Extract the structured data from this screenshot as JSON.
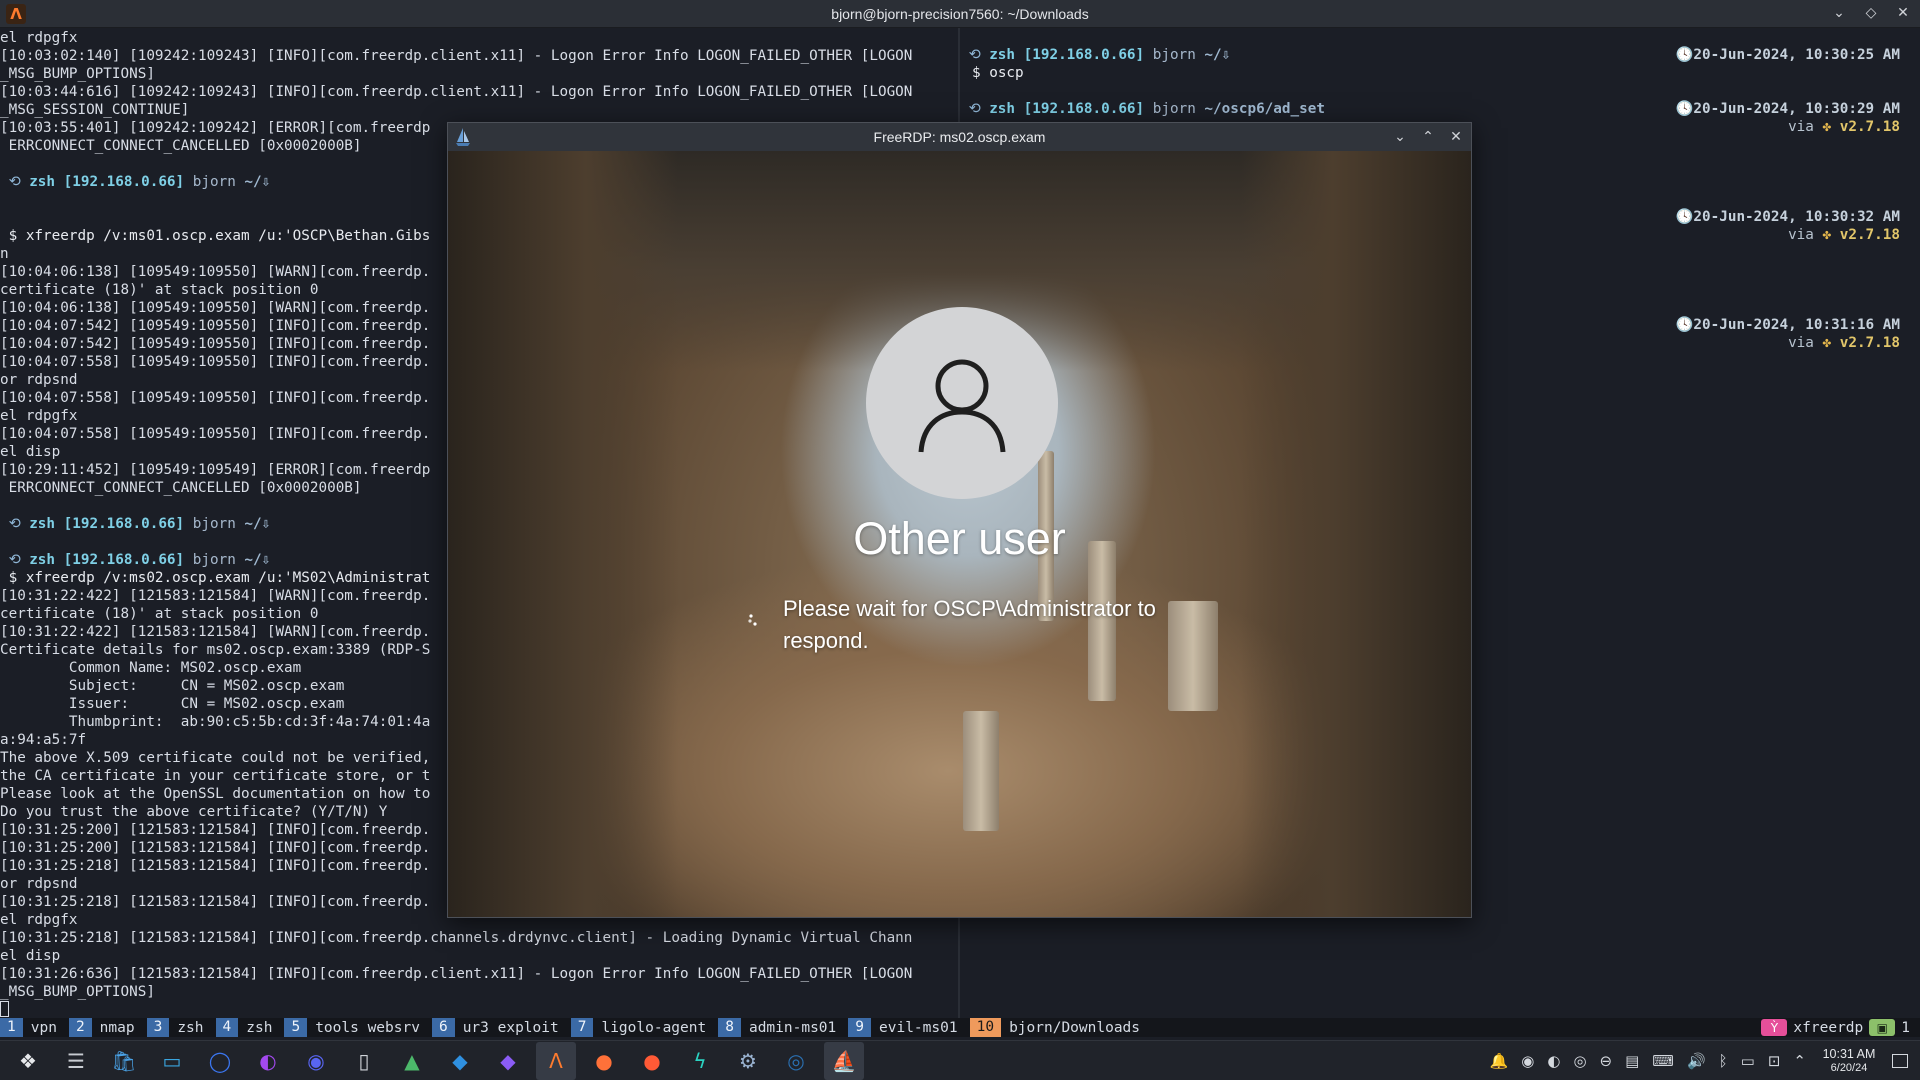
{
  "window": {
    "title": "bjorn@bjorn-precision7560: ~/Downloads",
    "controls": [
      "⌄",
      "◇",
      "✕"
    ]
  },
  "terminal_left": {
    "lines": [
      {
        "t": "out",
        "text": "el rdpgfx"
      },
      {
        "t": "out",
        "text": "[10:03:02:140] [109242:109243] [INFO][com.freerdp.client.x11] - Logon Error Info LOGON_FAILED_OTHER [LOGON"
      },
      {
        "t": "out",
        "text": "_MSG_BUMP_OPTIONS]"
      },
      {
        "t": "out",
        "text": "[10:03:44:616] [109242:109243] [INFO][com.freerdp.client.x11] - Logon Error Info LOGON_FAILED_OTHER [LOGON"
      },
      {
        "t": "out",
        "text": "_MSG_SESSION_CONTINUE]"
      },
      {
        "t": "out",
        "text": "[10:03:55:401] [109242:109242] [ERROR][com.freerdp"
      },
      {
        "t": "out",
        "text": " ERRCONNECT_CONNECT_CANCELLED [0x0002000B]"
      },
      {
        "t": "blank",
        "text": ""
      },
      {
        "t": "prompt",
        "zsh": "zsh",
        "ip": "[192.168.0.66]",
        "user": "bjorn",
        "path": "~/⇩"
      },
      {
        "t": "blank",
        "text": ""
      },
      {
        "t": "blank",
        "text": ""
      },
      {
        "t": "cmd",
        "text": " $ xfreerdp /v:ms01.oscp.exam /u:'OSCP\\Bethan.Gibs"
      },
      {
        "t": "out",
        "text": "n"
      },
      {
        "t": "out",
        "text": "[10:04:06:138] [109549:109550] [WARN][com.freerdp."
      },
      {
        "t": "out",
        "text": "certificate (18)' at stack position 0"
      },
      {
        "t": "out",
        "text": "[10:04:06:138] [109549:109550] [WARN][com.freerdp."
      },
      {
        "t": "out",
        "text": "[10:04:07:542] [109549:109550] [INFO][com.freerdp."
      },
      {
        "t": "out",
        "text": "[10:04:07:542] [109549:109550] [INFO][com.freerdp."
      },
      {
        "t": "out",
        "text": "[10:04:07:558] [109549:109550] [INFO][com.freerdp."
      },
      {
        "t": "out",
        "text": "or rdpsnd"
      },
      {
        "t": "out",
        "text": "[10:04:07:558] [109549:109550] [INFO][com.freerdp."
      },
      {
        "t": "out",
        "text": "el rdpgfx"
      },
      {
        "t": "out",
        "text": "[10:04:07:558] [109549:109550] [INFO][com.freerdp."
      },
      {
        "t": "out",
        "text": "el disp"
      },
      {
        "t": "out",
        "text": "[10:29:11:452] [109549:109549] [ERROR][com.freerdp"
      },
      {
        "t": "out",
        "text": " ERRCONNECT_CONNECT_CANCELLED [0x0002000B]"
      },
      {
        "t": "blank",
        "text": ""
      },
      {
        "t": "prompt",
        "zsh": "zsh",
        "ip": "[192.168.0.66]",
        "user": "bjorn",
        "path": "~/⇩"
      },
      {
        "t": "blank",
        "text": ""
      },
      {
        "t": "prompt",
        "zsh": "zsh",
        "ip": "[192.168.0.66]",
        "user": "bjorn",
        "path": "~/⇩"
      },
      {
        "t": "cmd",
        "text": " $ xfreerdp /v:ms02.oscp.exam /u:'MS02\\Administrat"
      },
      {
        "t": "out",
        "text": "[10:31:22:422] [121583:121584] [WARN][com.freerdp."
      },
      {
        "t": "out",
        "text": "certificate (18)' at stack position 0"
      },
      {
        "t": "out",
        "text": "[10:31:22:422] [121583:121584] [WARN][com.freerdp."
      },
      {
        "t": "out",
        "text": "Certificate details for ms02.oscp.exam:3389 (RDP-S"
      },
      {
        "t": "out",
        "text": "        Common Name: MS02.oscp.exam"
      },
      {
        "t": "out",
        "text": "        Subject:     CN = MS02.oscp.exam"
      },
      {
        "t": "out",
        "text": "        Issuer:      CN = MS02.oscp.exam"
      },
      {
        "t": "out",
        "text": "        Thumbprint:  ab:90:c5:5b:cd:3f:4a:74:01:4a"
      },
      {
        "t": "out",
        "text": "a:94:a5:7f"
      },
      {
        "t": "out",
        "text": "The above X.509 certificate could not be verified,"
      },
      {
        "t": "out",
        "text": "the CA certificate in your certificate store, or t"
      },
      {
        "t": "out",
        "text": "Please look at the OpenSSL documentation on how to"
      },
      {
        "t": "out",
        "text": "Do you trust the above certificate? (Y/T/N) Y"
      },
      {
        "t": "out",
        "text": "[10:31:25:200] [121583:121584] [INFO][com.freerdp."
      },
      {
        "t": "out",
        "text": "[10:31:25:200] [121583:121584] [INFO][com.freerdp."
      },
      {
        "t": "out",
        "text": "[10:31:25:218] [121583:121584] [INFO][com.freerdp."
      },
      {
        "t": "out",
        "text": "or rdpsnd"
      },
      {
        "t": "out",
        "text": "[10:31:25:218] [121583:121584] [INFO][com.freerdp."
      },
      {
        "t": "out",
        "text": "el rdpgfx"
      },
      {
        "t": "out",
        "text": "[10:31:25:218] [121583:121584] [INFO][com.freerdp.channels.drdynvc.client] - Loading Dynamic Virtual Chann"
      },
      {
        "t": "out",
        "text": "el disp"
      },
      {
        "t": "out",
        "text": "[10:31:26:636] [121583:121584] [INFO][com.freerdp.client.x11] - Logon Error Info LOGON_FAILED_OTHER [LOGON"
      },
      {
        "t": "out",
        "text": "_MSG_BUMP_OPTIONS]"
      },
      {
        "t": "cursor",
        "text": ""
      }
    ]
  },
  "terminal_right": {
    "lines": [
      {
        "t": "prompt",
        "zsh": "zsh",
        "ip": "[192.168.0.66]",
        "user": "bjorn",
        "path": "~/⇩",
        "ts": "20-Jun-2024, 10:30:25 AM"
      },
      {
        "t": "cmd",
        "text": "$ oscp"
      },
      {
        "t": "blank",
        "text": ""
      },
      {
        "t": "prompt",
        "zsh": "zsh",
        "ip": "[192.168.0.66]",
        "user": "bjorn",
        "path": "~/oscp6/ad_set",
        "ts": "20-Jun-2024, 10:30:29 AM"
      },
      {
        "t": "via",
        "via": "via",
        "ver": "v2.7.18"
      },
      {
        "t": "blank",
        "text": ""
      },
      {
        "t": "blank",
        "text": ""
      },
      {
        "t": "blank",
        "text": ""
      },
      {
        "t": "blank",
        "text": ""
      },
      {
        "t": "ts",
        "ts": "20-Jun-2024, 10:30:32 AM"
      },
      {
        "t": "via",
        "via": "via",
        "ver": "v2.7.18"
      },
      {
        "t": "blank",
        "text": ""
      },
      {
        "t": "blank",
        "text": ""
      },
      {
        "t": "blank",
        "text": ""
      },
      {
        "t": "blank",
        "text": ""
      },
      {
        "t": "ts",
        "ts": "20-Jun-2024, 10:31:16 AM"
      },
      {
        "t": "via",
        "via": "via",
        "ver": "v2.7.18"
      }
    ]
  },
  "rdp": {
    "title": "FreeRDP: ms02.oscp.exam",
    "controls": [
      "⌄",
      "⌃",
      "✕"
    ],
    "user_name": "Other user",
    "message": "Please wait for OSCP\\Administrator to respond."
  },
  "workspaces": [
    {
      "num": "1",
      "label": "vpn"
    },
    {
      "num": "2",
      "label": "nmap"
    },
    {
      "num": "3",
      "label": "zsh"
    },
    {
      "num": "4",
      "label": "zsh"
    },
    {
      "num": "5",
      "label": "tools websrv"
    },
    {
      "num": "6",
      "label": "ur3 exploit"
    },
    {
      "num": "7",
      "label": "ligolo-agent"
    },
    {
      "num": "8",
      "label": "admin-ms01"
    },
    {
      "num": "9",
      "label": "evil-ms01"
    },
    {
      "num": "10",
      "label": "bjorn/Downloads",
      "active": true
    }
  ],
  "ws_right": {
    "app": "xfreerdp",
    "count": "1"
  },
  "taskbar": {
    "apps": [
      {
        "name": "kde-launcher-icon",
        "glyph": "❖",
        "color": "#e6e8eb"
      },
      {
        "name": "task-manager-icon",
        "glyph": "☰",
        "color": "#c8ccd2"
      },
      {
        "name": "store-icon",
        "glyph": "🛍",
        "color": "#4aa3e8"
      },
      {
        "name": "file-manager-icon",
        "glyph": "▭",
        "color": "#3aa6e0"
      },
      {
        "name": "signal-icon",
        "glyph": "◯",
        "color": "#3b76f0"
      },
      {
        "name": "messenger-icon",
        "glyph": "◐",
        "color": "#a349f0"
      },
      {
        "name": "discord-icon",
        "glyph": "◉",
        "color": "#5865f2"
      },
      {
        "name": "phone-icon",
        "glyph": "▯",
        "color": "#cfd3d8"
      },
      {
        "name": "system-monitor-icon",
        "glyph": "▲",
        "color": "#4cb86a"
      },
      {
        "name": "vscode-icon",
        "glyph": "◆",
        "color": "#2f90e0"
      },
      {
        "name": "obsidian-icon",
        "glyph": "◆",
        "color": "#8b5cf6"
      },
      {
        "name": "alacritty-icon",
        "glyph": "Λ",
        "color": "#ff7b2e",
        "active": true
      },
      {
        "name": "firefox-icon",
        "glyph": "●",
        "color": "#ff7139"
      },
      {
        "name": "firefox-dev-icon",
        "glyph": "●",
        "color": "#ff5a36"
      },
      {
        "name": "bolt-app-icon",
        "glyph": "ϟ",
        "color": "#2bd3c2"
      },
      {
        "name": "settings-icon",
        "glyph": "⚙",
        "color": "#9ab3d1"
      },
      {
        "name": "steam-icon",
        "glyph": "◎",
        "color": "#2a6fb0"
      },
      {
        "name": "freerdp-icon",
        "glyph": "⛵",
        "color": "#6aa0d8",
        "active": true
      }
    ],
    "tray": [
      {
        "name": "notifications-icon",
        "glyph": "🔔"
      },
      {
        "name": "discord-tray-icon",
        "glyph": "◉"
      },
      {
        "name": "messenger-tray-icon",
        "glyph": "◐"
      },
      {
        "name": "steam-tray-icon",
        "glyph": "◎"
      },
      {
        "name": "vpn-tray-icon",
        "glyph": "⊖"
      },
      {
        "name": "clipboard-icon",
        "glyph": "▤"
      },
      {
        "name": "keyboard-icon",
        "glyph": "⌨"
      },
      {
        "name": "volume-icon",
        "glyph": "🔊"
      },
      {
        "name": "bluetooth-icon",
        "glyph": "ᛒ"
      },
      {
        "name": "display-icon",
        "glyph": "▭"
      },
      {
        "name": "network-icon",
        "glyph": "⊡"
      },
      {
        "name": "expand-tray-icon",
        "glyph": "⌃"
      }
    ],
    "time": "10:31 AM",
    "date": "6/20/24"
  }
}
